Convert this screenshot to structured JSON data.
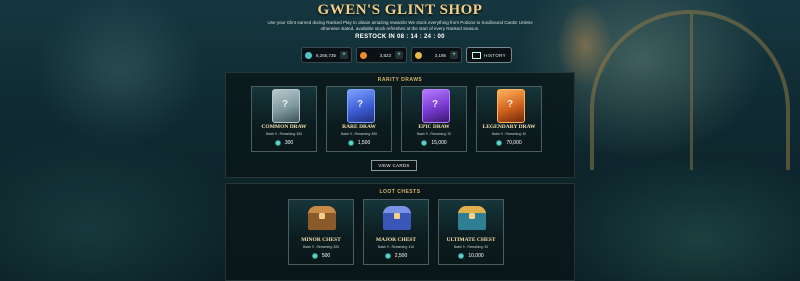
{
  "header": {
    "title": "GWEN'S GLINT SHOP",
    "description": "Use your Glint earned during Ranked Play to obtain amazing rewards! We stock everything from Potions to Soulbound Cards! Unless otherwise stated, available stock refreshes at the start of every Ranked Season.",
    "restock": "RESTOCK IN 08 : 14 : 24 : 00"
  },
  "currencies": [
    {
      "icon": "glint-crystal-icon",
      "value": "6,265,735",
      "color": "#4fc3c8"
    },
    {
      "icon": "fire-dust-icon",
      "value": "3,823",
      "color": "#f08a2a"
    },
    {
      "icon": "potion-icon",
      "value": "3,195",
      "color": "#e6b84a"
    }
  ],
  "history_label": "HISTORY",
  "rarity_draws": {
    "title": "RARITY DRAWS",
    "cards": [
      {
        "name": "COMMON DRAW",
        "batch": "Batch 9 - Remaining: 826",
        "price": "300",
        "color": "#7f9aa0",
        "accent": "#b9c8cc"
      },
      {
        "name": "RARE DRAW",
        "batch": "Batch 9 - Remaining: 826",
        "price": "1,500",
        "color": "#3d5fd6",
        "accent": "#7fa0ff"
      },
      {
        "name": "EPIC DRAW",
        "batch": "Batch 9 - Remaining: 30",
        "price": "15,000",
        "color": "#7a3ad0",
        "accent": "#b57cff"
      },
      {
        "name": "LEGENDARY DRAW",
        "batch": "Batch 9 - Remaining: 30",
        "price": "70,000",
        "color": "#d0621e",
        "accent": "#ffb35a"
      }
    ],
    "view_cards_label": "VIEW CARDS"
  },
  "loot_chests": {
    "title": "LOOT CHESTS",
    "chests": [
      {
        "name": "MINOR CHEST",
        "batch": "Batch 9 - Remaining: 826",
        "price": "500",
        "color": "#8a5a2a",
        "accent": "#c98a45"
      },
      {
        "name": "MAJOR CHEST",
        "batch": "Batch 9 - Remaining: 416",
        "price": "2,500",
        "color": "#3a56b8",
        "accent": "#7b93e6"
      },
      {
        "name": "ULTIMATE CHEST",
        "batch": "Batch 9 - Remaining: 30",
        "price": "10,000",
        "color": "#2e7f93",
        "accent": "#e0b04a"
      }
    ]
  }
}
